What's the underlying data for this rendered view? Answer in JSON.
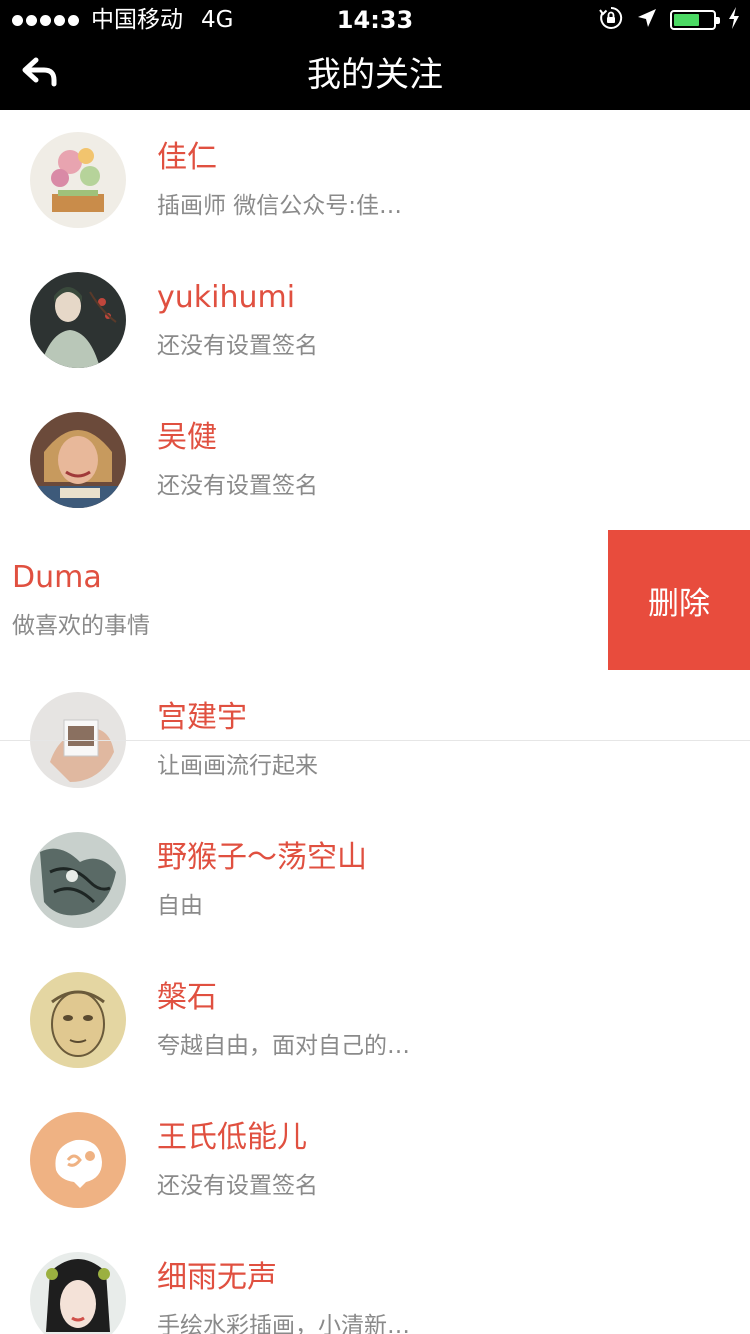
{
  "status_bar": {
    "carrier": "中国移动",
    "network": "4G",
    "time": "14:33",
    "battery_level": 0.65,
    "icons": [
      "signal-dots-icon",
      "orientation-lock-icon",
      "location-arrow-icon",
      "battery-icon",
      "charging-bolt-icon"
    ]
  },
  "nav": {
    "back_icon": "back-arrow-icon",
    "title": "我的关注"
  },
  "follow_list": [
    {
      "name": "佳仁",
      "signature": "插画师 微信公众号:佳…"
    },
    {
      "name": "yukihumi",
      "signature": "还没有设置签名"
    },
    {
      "name": "吴健",
      "signature": "还没有设置签名"
    },
    {
      "name": "Duma",
      "signature": "做喜欢的事情",
      "swiped": true,
      "action_label": "删除"
    },
    {
      "name": "宫建宇",
      "signature": "让画画流行起来"
    },
    {
      "name": "野猴子～荡空山",
      "signature": "自由"
    },
    {
      "name": "槃石",
      "signature": "夸越自由，面对自己的…"
    },
    {
      "name": "王氏低能儿",
      "signature": "还没有设置签名"
    },
    {
      "name": "细雨无声",
      "signature": "手绘水彩插画，小清新…"
    }
  ],
  "colors": {
    "name_text": "#e05040",
    "signature_text": "#8a8a8a",
    "delete_button": "#e84c3d",
    "bar_background": "#000000",
    "battery_fill": "#4cd964"
  }
}
